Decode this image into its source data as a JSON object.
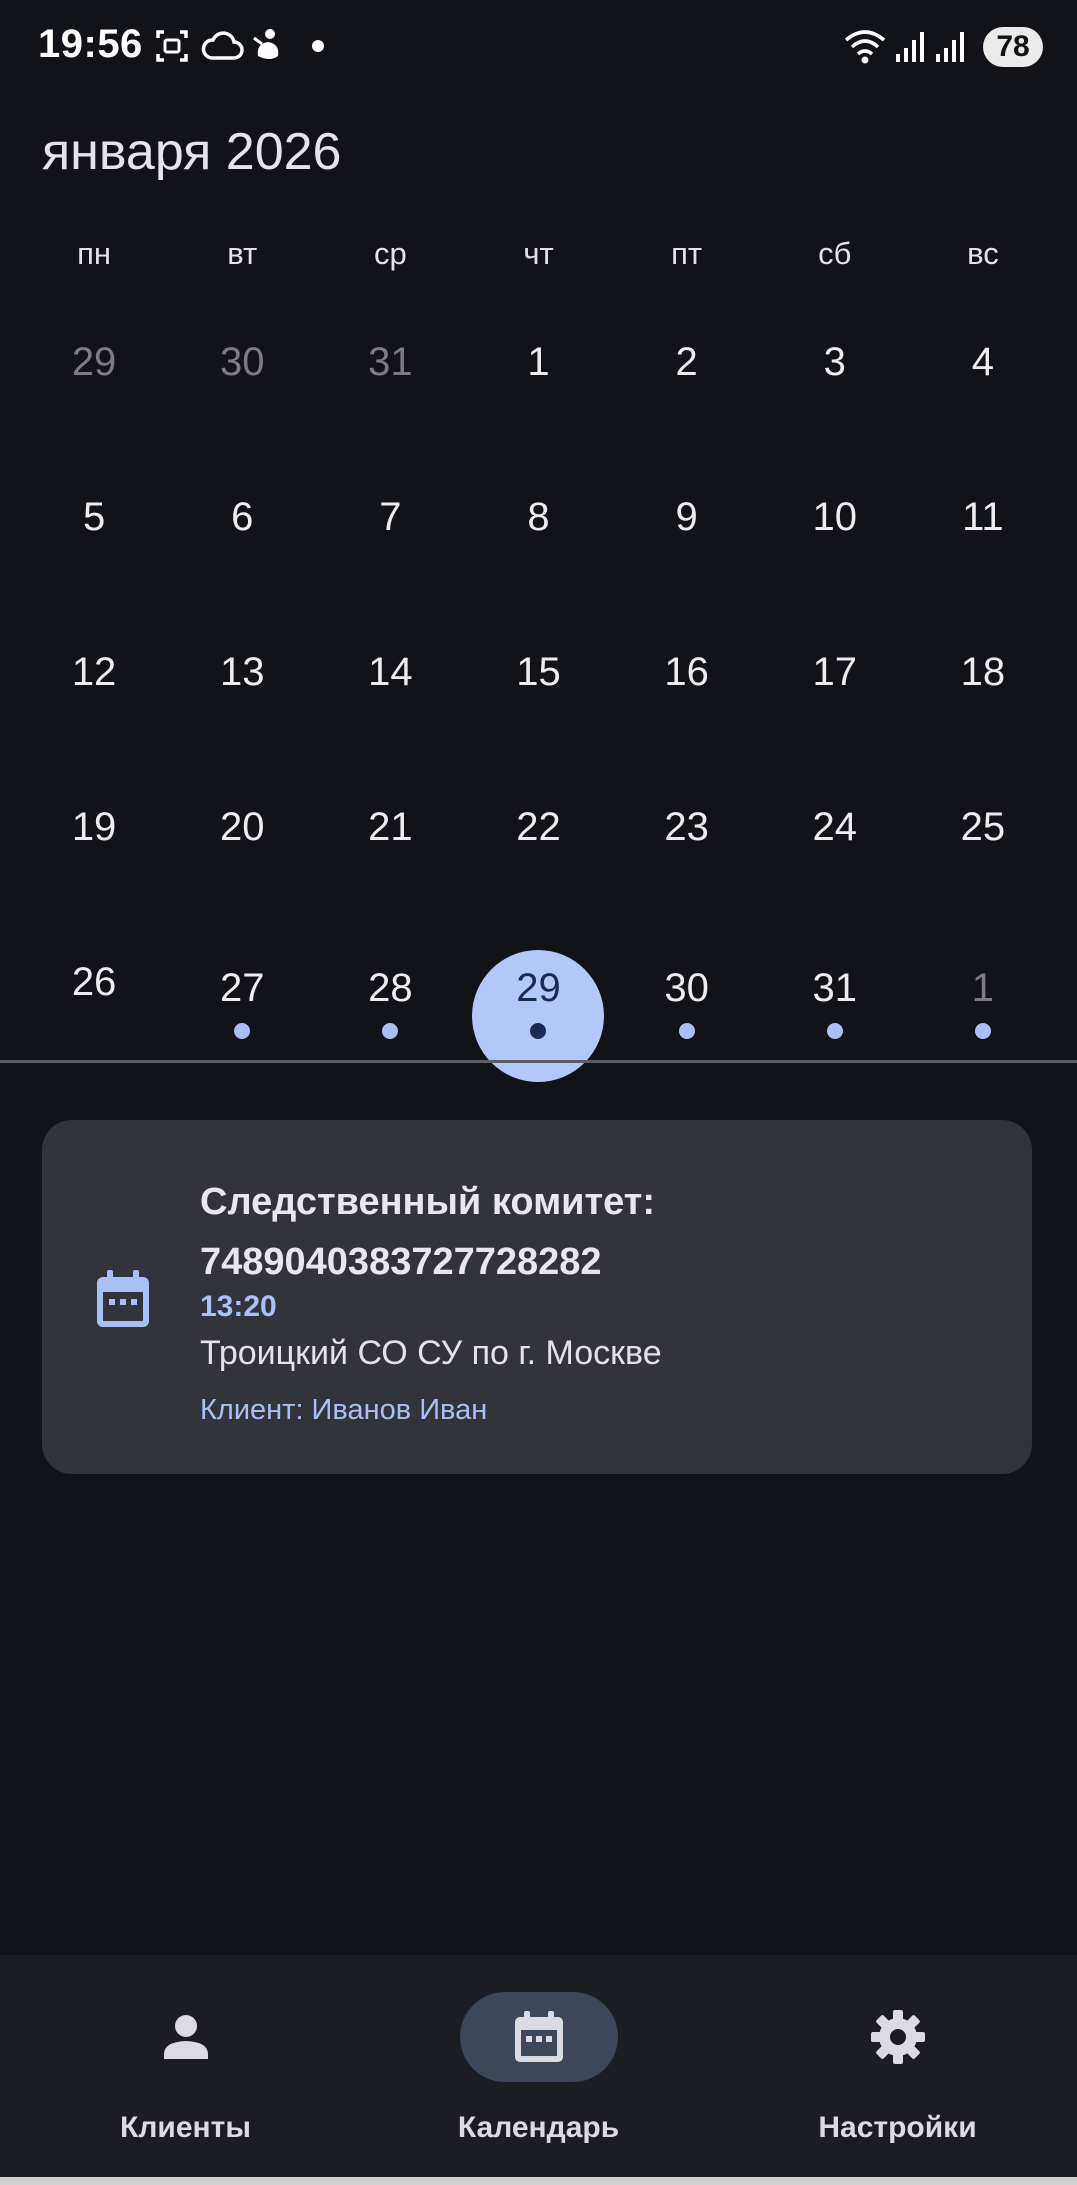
{
  "status_bar": {
    "time": "19:56",
    "battery": "78",
    "icons": [
      "screenshot-icon",
      "cloud-icon",
      "figure-icon",
      "dot-icon",
      "wifi-icon",
      "signal-icon",
      "signal-icon"
    ]
  },
  "calendar": {
    "month_title": "января 2026",
    "weekdays": [
      "пн",
      "вт",
      "ср",
      "чт",
      "пт",
      "сб",
      "вс"
    ],
    "weeks": [
      [
        {
          "n": "29",
          "out": true
        },
        {
          "n": "30",
          "out": true
        },
        {
          "n": "31",
          "out": true
        },
        {
          "n": "1"
        },
        {
          "n": "2"
        },
        {
          "n": "3"
        },
        {
          "n": "4"
        }
      ],
      [
        {
          "n": "5"
        },
        {
          "n": "6"
        },
        {
          "n": "7"
        },
        {
          "n": "8"
        },
        {
          "n": "9"
        },
        {
          "n": "10"
        },
        {
          "n": "11"
        }
      ],
      [
        {
          "n": "12"
        },
        {
          "n": "13"
        },
        {
          "n": "14"
        },
        {
          "n": "15"
        },
        {
          "n": "16"
        },
        {
          "n": "17"
        },
        {
          "n": "18"
        }
      ],
      [
        {
          "n": "19"
        },
        {
          "n": "20"
        },
        {
          "n": "21"
        },
        {
          "n": "22"
        },
        {
          "n": "23"
        },
        {
          "n": "24"
        },
        {
          "n": "25"
        }
      ],
      [
        {
          "n": "26"
        },
        {
          "n": "27",
          "event": true
        },
        {
          "n": "28",
          "event": true
        },
        {
          "n": "29",
          "event": true,
          "selected": true
        },
        {
          "n": "30",
          "event": true
        },
        {
          "n": "31",
          "event": true
        },
        {
          "n": "1",
          "event": true,
          "out": true
        }
      ]
    ],
    "accent_color": "#a8c0f7",
    "selected_color": "#b3c8fa"
  },
  "event": {
    "title": "Следственный комитет: 7489040383727728282",
    "time": "13:20",
    "place": "Троицкий СО СУ по г. Москве",
    "client": "Клиент: Иванов Иван",
    "icon": "calendar-icon"
  },
  "nav": {
    "items": [
      {
        "label": "Клиенты",
        "icon": "person-icon",
        "active": false
      },
      {
        "label": "Календарь",
        "icon": "calendar-icon",
        "active": true
      },
      {
        "label": "Настройки",
        "icon": "gear-icon",
        "active": false
      }
    ]
  }
}
